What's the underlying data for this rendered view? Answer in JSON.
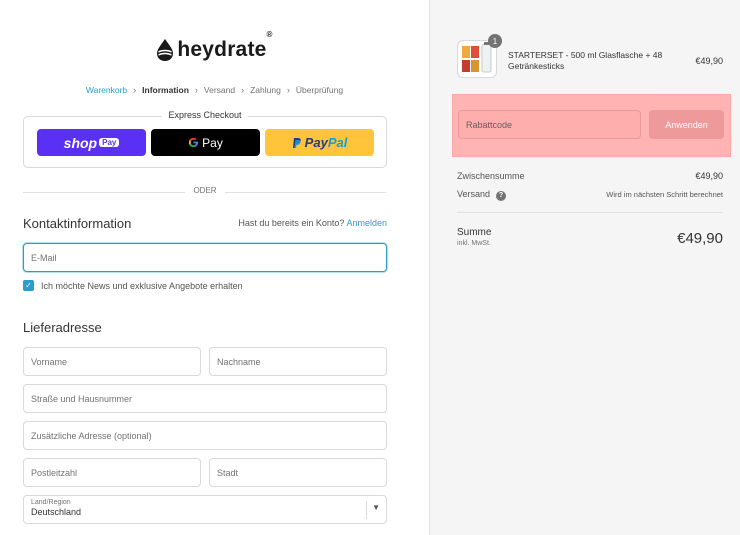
{
  "brand": {
    "name": "heydrate",
    "reg": "®"
  },
  "breadcrumb": [
    {
      "label": "Warenkorb",
      "state": "link"
    },
    {
      "label": "Information",
      "state": "active"
    },
    {
      "label": "Versand",
      "state": "inactive"
    },
    {
      "label": "Zahlung",
      "state": "inactive"
    },
    {
      "label": "Überprüfung",
      "state": "inactive"
    }
  ],
  "express": {
    "title": "Express Checkout",
    "shop_pay": {
      "word": "shop",
      "badge": "Pay"
    },
    "gpay": {
      "letter": "G",
      "word": "Pay"
    },
    "paypal": {
      "pay": "Pay",
      "pal": "Pal"
    }
  },
  "divider_or": "ODER",
  "contact": {
    "title": "Kontaktinformation",
    "login_prompt": "Hast du bereits ein Konto?",
    "login_link": "Anmelden",
    "email_placeholder": "E-Mail",
    "newsletter_label": "Ich möchte News und exklusive Angebote erhalten",
    "newsletter_checked": true
  },
  "shipping": {
    "title": "Lieferadresse",
    "first_name": "Vorname",
    "last_name": "Nachname",
    "street": "Straße und Hausnummer",
    "address2": "Zusätzliche Adresse (optional)",
    "zip": "Postleitzahl",
    "city": "Stadt",
    "country_label": "Land/Region",
    "country_value": "Deutschland"
  },
  "summary": {
    "product": {
      "name": "STARTERSET - 500 ml Glasflasche + 48 Getränkesticks",
      "price": "€49,90",
      "quantity": "1"
    },
    "discount_placeholder": "Rabattcode",
    "apply_label": "Anwenden",
    "subtotal_label": "Zwischensumme",
    "subtotal_value": "€49,90",
    "shipping_label": "Versand",
    "shipping_help": "?",
    "shipping_value": "Wird im nächsten Schritt berechnet",
    "total_label": "Summe",
    "total_sub": "inkl. MwSt.",
    "total_value": "€49,90"
  },
  "colors": {
    "accent": "#2a9dcc",
    "shop_pay": "#5a31f4",
    "paypal_yellow": "#ffc439",
    "highlight": "#ffb3b3"
  }
}
